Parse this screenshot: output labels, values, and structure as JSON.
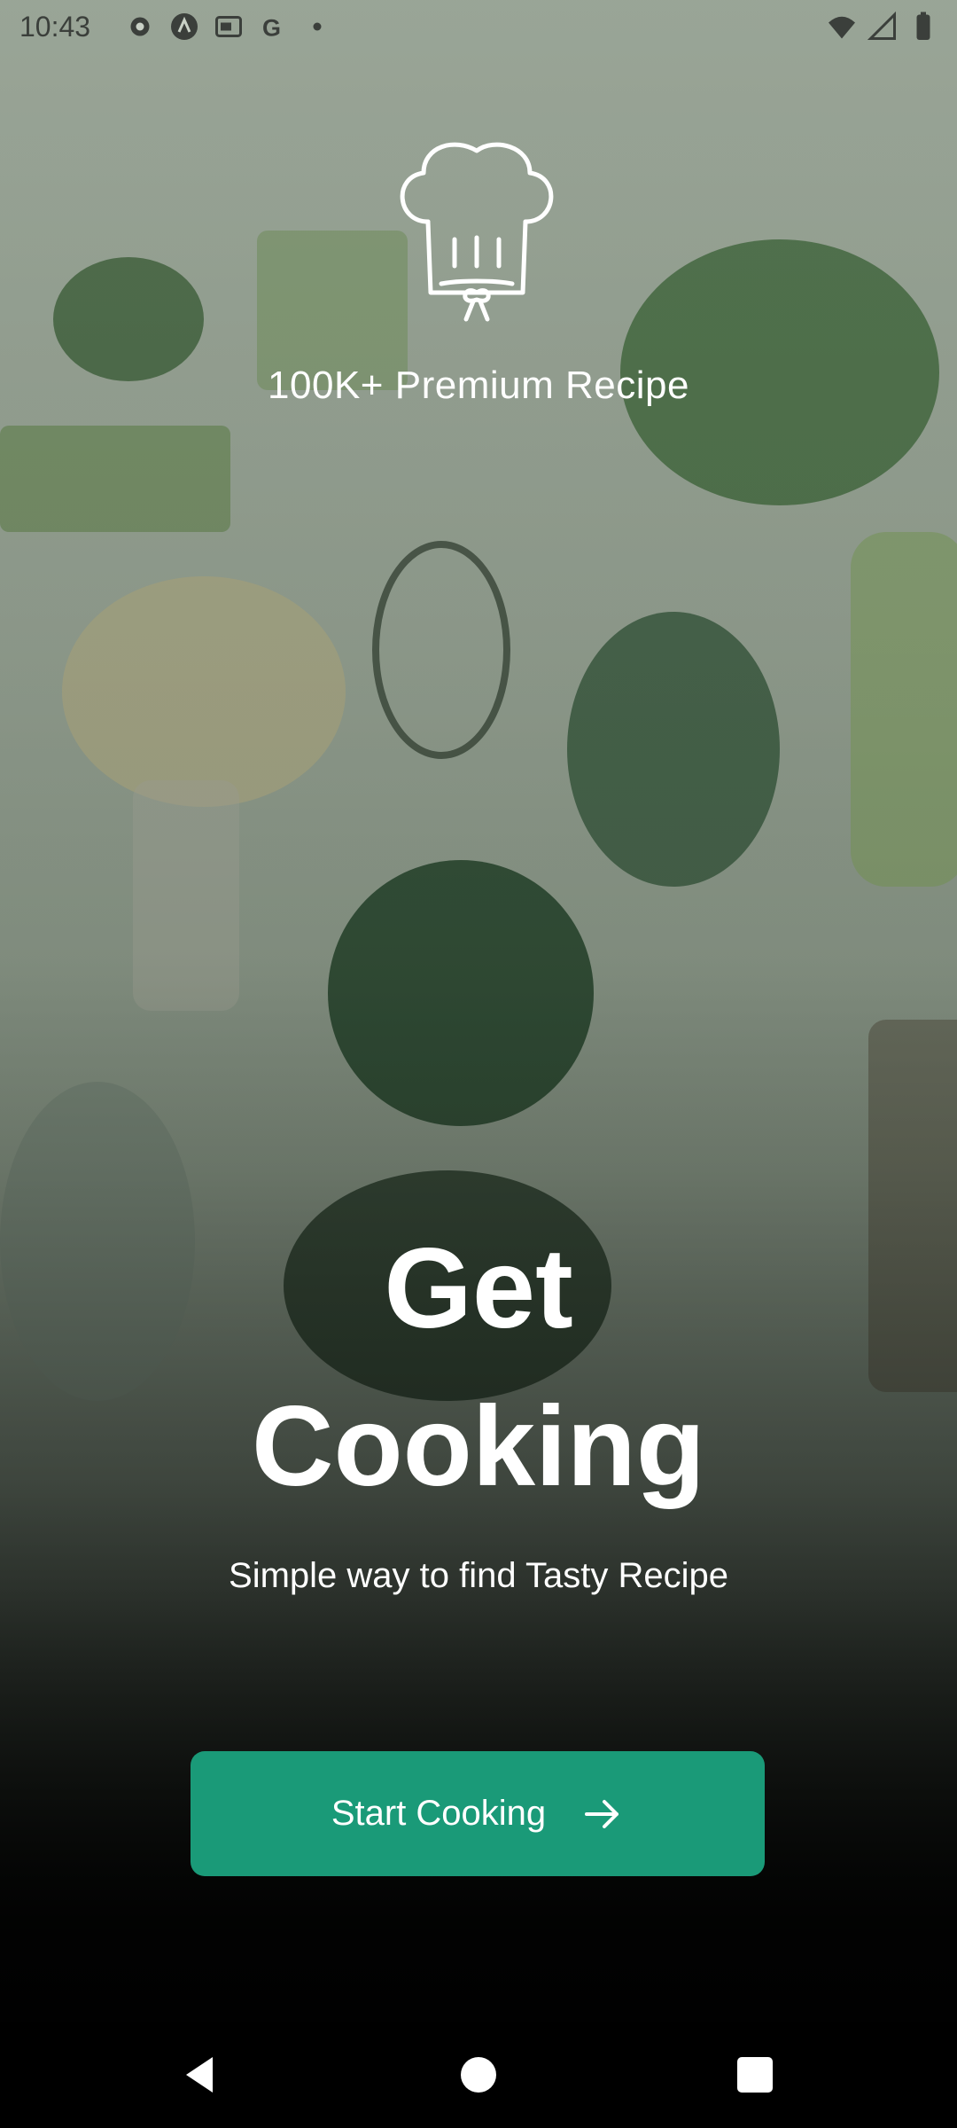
{
  "status_bar": {
    "time": "10:43",
    "left_icons": [
      "settings-icon",
      "android-auto-icon",
      "media-icon",
      "google-icon",
      "dot-icon"
    ],
    "right_icons": [
      "wifi-icon",
      "signal-icon",
      "battery-icon"
    ]
  },
  "branding": {
    "logo_icon": "chef-hat-icon",
    "tagline": "100K+ Premium Recipe"
  },
  "hero": {
    "headline_line1": "Get",
    "headline_line2": "Cooking",
    "subtitle": "Simple way to find Tasty Recipe"
  },
  "cta": {
    "label": "Start Cooking",
    "icon": "arrow-right-icon",
    "color": "#1a9a78"
  },
  "nav_bar": {
    "buttons": [
      "back-icon",
      "home-icon",
      "recents-icon"
    ]
  }
}
